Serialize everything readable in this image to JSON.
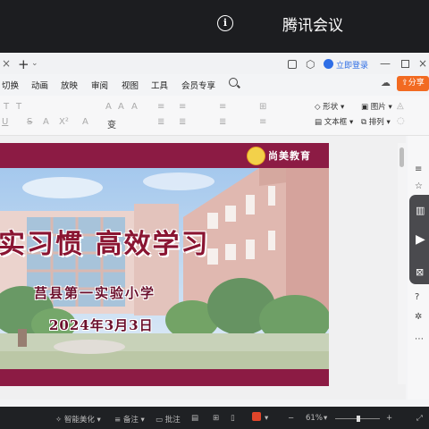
{
  "meeting": {
    "title": "腾讯会议",
    "info_glyph": "i"
  },
  "window": {
    "tab_close": "×",
    "tab_add": "+",
    "tab_more": "⌄",
    "login_label": "立即登录",
    "min": "—",
    "close": "×"
  },
  "menu": {
    "items": [
      "切换",
      "动画",
      "放映",
      "审阅",
      "视图",
      "工具",
      "会员专享"
    ],
    "share_label": "分享",
    "cloud_icon": "☁"
  },
  "ribbon": {
    "shape_label": "形状",
    "image_label": "图片",
    "textbox_label": "文本框",
    "arrange_label": "排列",
    "row1": [
      "T",
      "T",
      "A",
      "A",
      "A",
      "≡",
      "≡",
      "≡",
      "⊞"
    ],
    "row2": [
      "U",
      "S",
      "A",
      "X²",
      "A",
      "≣",
      "≣",
      "≣",
      "≡"
    ]
  },
  "slide": {
    "logo_text": "尚美教育",
    "title": "实习惯 高效学习",
    "school": "莒县第一实验小学",
    "date": "2024年3月3日"
  },
  "rail": {
    "icons": [
      "≡",
      "☆",
      "⌂",
      "◇",
      "?",
      "✲",
      "⋯"
    ],
    "play_glyph": "▶"
  },
  "status": {
    "smart_label": "智能美化",
    "notes_label": "备注",
    "comments_label": "批注",
    "zoom": "61%",
    "zoom_minus": "−",
    "zoom_plus": "+"
  },
  "colors": {
    "accent": "#8c1b44",
    "share": "#f26a21",
    "login": "#2e6ee6"
  }
}
